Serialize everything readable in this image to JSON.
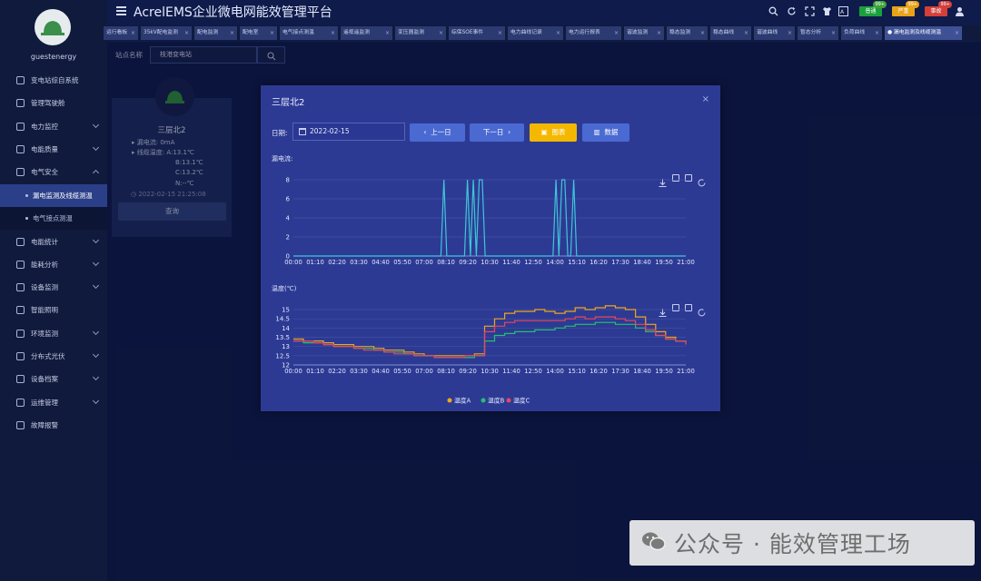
{
  "app": {
    "title": "AcrelEMS企业微电网能效管理平台",
    "username": "guestenergy"
  },
  "header": {
    "badges": [
      {
        "label": "普通",
        "count": "99+",
        "color": "#1aa03c"
      },
      {
        "label": "严重",
        "count": "99+",
        "color": "#e8a317"
      },
      {
        "label": "事故",
        "count": "99+",
        "color": "#d43f3a"
      }
    ]
  },
  "sidebar": {
    "items": [
      {
        "label": "变电站综自系统",
        "icon": "substation-icon"
      },
      {
        "label": "管理驾驶舱",
        "icon": "dashboard-icon"
      },
      {
        "label": "电力监控",
        "icon": "power-monitor-icon"
      },
      {
        "label": "电能质量",
        "icon": "quality-icon"
      },
      {
        "label": "电气安全",
        "icon": "safety-icon"
      },
      {
        "label": "漏电监测及线缆测温",
        "icon": ""
      },
      {
        "label": "电气接点测温",
        "icon": ""
      },
      {
        "label": "电能统计",
        "icon": "statistics-icon"
      },
      {
        "label": "能耗分析",
        "icon": "analysis-icon"
      },
      {
        "label": "设备监测",
        "icon": "device-icon"
      },
      {
        "label": "智能照明",
        "icon": "lighting-icon"
      },
      {
        "label": "环境监测",
        "icon": "environment-icon"
      },
      {
        "label": "分布式光伏",
        "icon": "solar-icon"
      },
      {
        "label": "设备档案",
        "icon": "archive-icon"
      },
      {
        "label": "运维管理",
        "icon": "maintenance-icon"
      },
      {
        "label": "故障报警",
        "icon": "alarm-icon"
      }
    ]
  },
  "tabs": [
    "运行看板",
    "35kV配电监测",
    "配电监测",
    "配电室",
    "电气接点测温",
    "遥视遥监测",
    "变压器监测",
    "综保SOE事件",
    "电力曲线记录",
    "电力运行报表",
    "谐波监测",
    "稳态监测",
    "稳态曲线",
    "谐波曲线",
    "暂态分析",
    "负荷曲线",
    "漏电监测及线缆测温"
  ],
  "station": {
    "label": "站点名称",
    "value": "枝港变电站"
  },
  "card": {
    "name": "三层北2",
    "leak": "漏电流:  0mA",
    "temp_label": "线缆温度:  A:13.1℃",
    "temp_b": "B:13.1℃",
    "temp_c": "C:13.2℃",
    "temp_n": "N:--℃",
    "time": "2022-02-15 21:25:08",
    "query": "查询"
  },
  "modal": {
    "title": "三层北2",
    "close": "×",
    "date_label": "日期:",
    "date_value": "2022-02-15",
    "prev": "上一日",
    "next": "下一日",
    "table": "图表",
    "data": "数据"
  },
  "chart_data": [
    {
      "type": "line",
      "title": "漏电流:",
      "ylim": [
        0,
        8
      ],
      "yticks": [
        0,
        2,
        4,
        6,
        8
      ],
      "categories": [
        "00:00",
        "01:10",
        "02:20",
        "03:30",
        "04:40",
        "05:50",
        "07:00",
        "08:10",
        "09:20",
        "10:30",
        "11:40",
        "12:50",
        "14:00",
        "15:10",
        "16:20",
        "17:30",
        "18:40",
        "19:50",
        "21:00"
      ],
      "series": [
        {
          "values": [
            0,
            0,
            0,
            0,
            0,
            0,
            0,
            0,
            0,
            0,
            0,
            0,
            0,
            0,
            0,
            0,
            0,
            0,
            0,
            0,
            0,
            0,
            0,
            0,
            0,
            0,
            0,
            0,
            0,
            0,
            0,
            0,
            0,
            0,
            0,
            0,
            0,
            0,
            0,
            0,
            0,
            0,
            0,
            0,
            0,
            0,
            0,
            0,
            0,
            0,
            0,
            8,
            0,
            0,
            0,
            0,
            0,
            0,
            0,
            8,
            0,
            8,
            0,
            8,
            8,
            0,
            0,
            0,
            0,
            0,
            0,
            0,
            0,
            0,
            0,
            0,
            0,
            0,
            0,
            0,
            0,
            0,
            0,
            0,
            0,
            0,
            0,
            0,
            0,
            8,
            0,
            8,
            8,
            0,
            0,
            8,
            0,
            0,
            0,
            0,
            0,
            0,
            0,
            0,
            0,
            0,
            0,
            0,
            0,
            0,
            0,
            0,
            0,
            0,
            0,
            0,
            0,
            0,
            0,
            0,
            0,
            0,
            0,
            0,
            0,
            0,
            0,
            0,
            0,
            0,
            0,
            0,
            0,
            0
          ],
          "color": "#3ec6d9"
        }
      ]
    },
    {
      "type": "line",
      "title": "温度(℃)",
      "ylim": [
        12,
        15
      ],
      "yticks": [
        12,
        12.5,
        13,
        13.5,
        14,
        14.5,
        15
      ],
      "categories": [
        "00:00",
        "01:10",
        "02:20",
        "03:30",
        "04:40",
        "05:50",
        "07:00",
        "08:10",
        "09:20",
        "10:30",
        "11:40",
        "12:50",
        "14:00",
        "15:10",
        "16:20",
        "17:30",
        "18:40",
        "19:50",
        "21:00"
      ],
      "series": [
        {
          "name": "温度A",
          "color": "#f0a51f",
          "values": [
            13.4,
            13.3,
            13.3,
            13.2,
            13.1,
            13.1,
            13.0,
            13.0,
            12.9,
            12.8,
            12.8,
            12.7,
            12.6,
            12.5,
            12.5,
            12.5,
            12.5,
            12.5,
            12.6,
            14.1,
            14.5,
            14.8,
            14.9,
            14.9,
            15.0,
            14.9,
            14.8,
            14.9,
            15.1,
            15.0,
            15.1,
            15.2,
            15.1,
            15.0,
            14.6,
            14.2,
            13.8,
            13.5,
            13.3,
            13.2
          ]
        },
        {
          "name": "温度B",
          "color": "#22c26e",
          "values": [
            13.3,
            13.2,
            13.2,
            13.1,
            13.0,
            13.0,
            12.9,
            12.9,
            12.8,
            12.7,
            12.7,
            12.6,
            12.5,
            12.5,
            12.4,
            12.4,
            12.4,
            12.4,
            12.5,
            13.3,
            13.6,
            13.7,
            13.8,
            13.8,
            13.9,
            13.9,
            14.0,
            14.1,
            14.2,
            14.2,
            14.3,
            14.3,
            14.2,
            14.2,
            14.0,
            13.8,
            13.6,
            13.4,
            13.3,
            13.2
          ]
        },
        {
          "name": "温度C",
          "color": "#e8465b",
          "values": [
            13.3,
            13.3,
            13.2,
            13.1,
            13.0,
            13.0,
            12.9,
            12.8,
            12.8,
            12.7,
            12.6,
            12.6,
            12.5,
            12.5,
            12.4,
            12.4,
            12.4,
            12.5,
            12.5,
            13.8,
            14.1,
            14.3,
            14.4,
            14.4,
            14.4,
            14.4,
            14.4,
            14.5,
            14.6,
            14.5,
            14.6,
            14.6,
            14.5,
            14.4,
            14.2,
            13.9,
            13.6,
            13.4,
            13.3,
            13.1
          ]
        }
      ]
    }
  ],
  "watermark": {
    "text": "公众号 · 能效管理工场"
  }
}
